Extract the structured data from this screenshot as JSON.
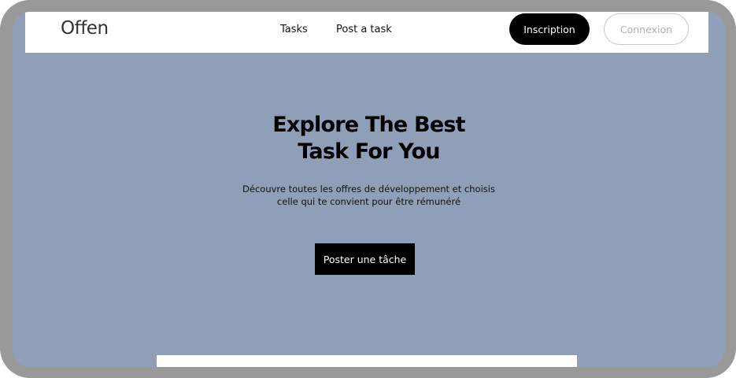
{
  "nav": {
    "logo": "Offen",
    "links": [
      "Tasks",
      "Post a task"
    ],
    "signup_label": "Inscription",
    "login_label": "Connexion"
  },
  "hero": {
    "title_line1": "Explore The Best",
    "title_line2": "Task For You",
    "subtitle_line1": "Découvre toutes les offres de développement et choisis",
    "subtitle_line2": "celle qui te convient pour être rémunéré",
    "cta_label": "Poster une tâche"
  },
  "colors": {
    "hero_background": "#8f9fb8",
    "primary_button": "#000000",
    "frame": "#999999"
  }
}
